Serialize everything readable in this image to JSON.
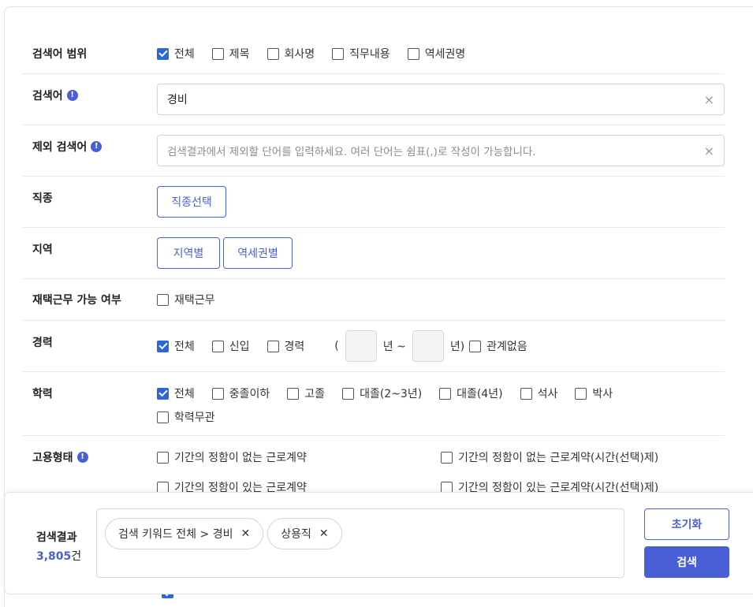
{
  "search_scope": {
    "label": "검색어 범위",
    "options": [
      {
        "label": "전체",
        "checked": true
      },
      {
        "label": "제목",
        "checked": false
      },
      {
        "label": "회사명",
        "checked": false
      },
      {
        "label": "직무내용",
        "checked": false
      },
      {
        "label": "역세권명",
        "checked": false
      }
    ]
  },
  "keyword": {
    "label": "검색어",
    "value": "경비",
    "clear_icon": "×"
  },
  "exclude_keyword": {
    "label": "제외 검색어",
    "placeholder": "검색결과에서 제외할 단어를 입력하세요. 여러 단어는 쉼표(,)로 작성이 가능합니다.",
    "clear_icon": "×"
  },
  "job_type": {
    "label": "직종",
    "button": "직종선택"
  },
  "region": {
    "label": "지역",
    "by_region": "지역별",
    "by_station": "역세권별"
  },
  "remote": {
    "label": "재택근무 가능 여부",
    "option": "재택근무",
    "checked": false
  },
  "career": {
    "label": "경력",
    "options": [
      {
        "label": "전체",
        "checked": true
      },
      {
        "label": "신입",
        "checked": false
      },
      {
        "label": "경력",
        "checked": false
      }
    ],
    "open_paren": "(",
    "year_from_suffix": "년 ~",
    "year_to_suffix": "년)",
    "any_label": "관계없음",
    "any_checked": false
  },
  "education": {
    "label": "학력",
    "options": [
      {
        "label": "전체",
        "checked": true
      },
      {
        "label": "중졸이하",
        "checked": false
      },
      {
        "label": "고졸",
        "checked": false
      },
      {
        "label": "대졸(2~3년)",
        "checked": false
      },
      {
        "label": "대졸(4년)",
        "checked": false
      },
      {
        "label": "석사",
        "checked": false
      },
      {
        "label": "박사",
        "checked": false
      },
      {
        "label": "학력무관",
        "checked": false
      }
    ]
  },
  "employment": {
    "label": "고용형태",
    "options": [
      {
        "label": "기간의 정함이 없는 근로계약",
        "checked": false
      },
      {
        "label": "기간의 정함이 없는 근로계약(시간(선택)제)",
        "checked": false
      },
      {
        "label": "기간의 정함이 있는 근로계약",
        "checked": false
      },
      {
        "label": "기간의 정함이 있는 근로계약(시간(선택)제)",
        "checked": false
      }
    ]
  },
  "results": {
    "title": "검색결과",
    "count": "3,805",
    "unit": "건",
    "tags": [
      {
        "label": "검색 키워드 전체 > 경비"
      },
      {
        "label": "상용직"
      }
    ],
    "reset": "초기화",
    "search": "검색"
  },
  "info_icon": "!",
  "accent_color": "#4a5fd6",
  "checkbox_color": "#2b67d8"
}
